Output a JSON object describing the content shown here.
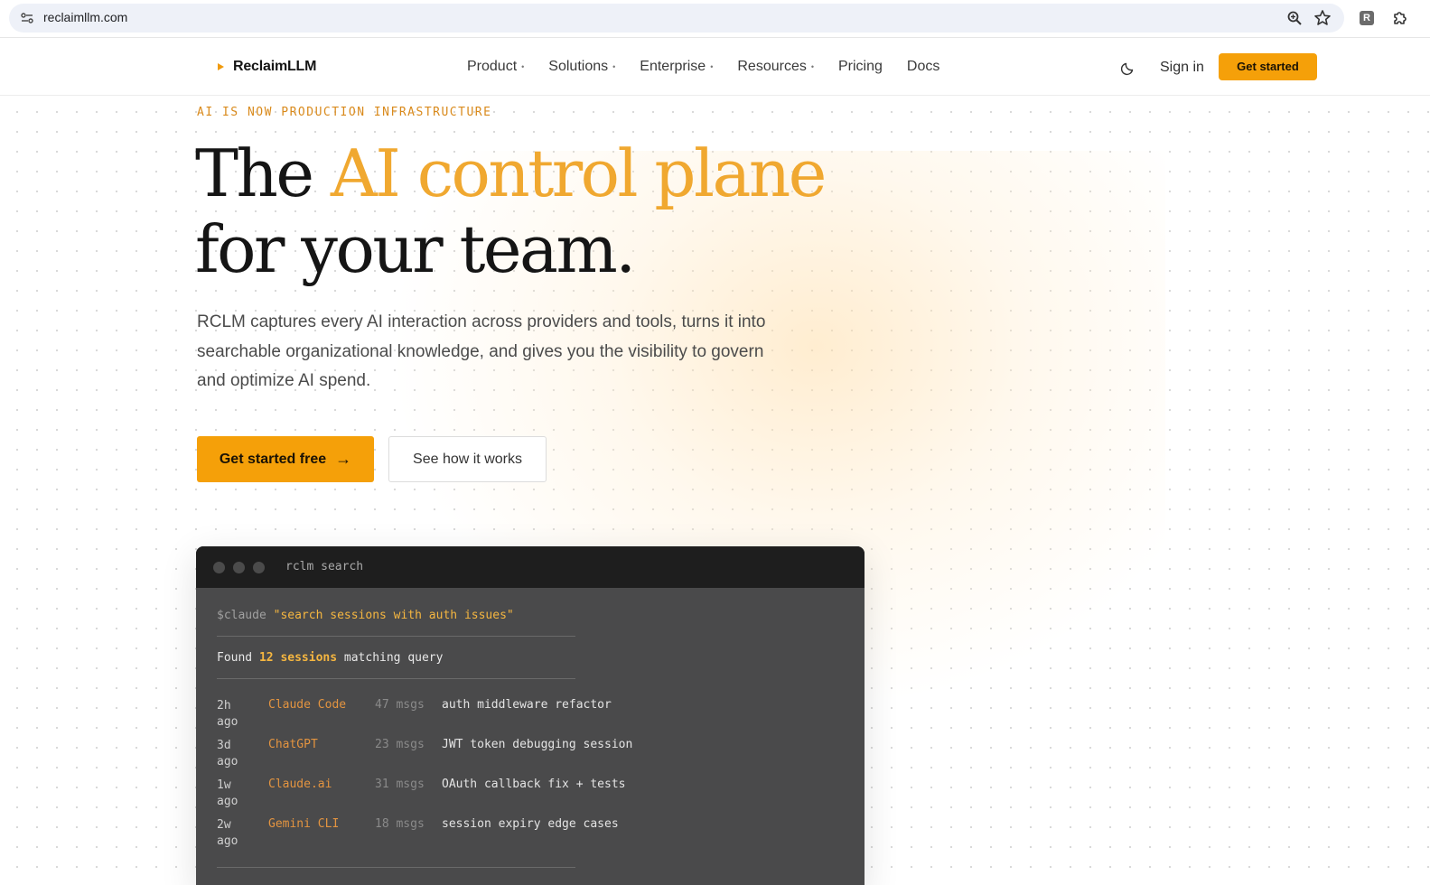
{
  "browser": {
    "url": "reclaimllm.com",
    "extension_letter": "R"
  },
  "nav": {
    "brand": "ReclaimLLM",
    "links": [
      {
        "label": "Product",
        "has_caret": true
      },
      {
        "label": "Solutions",
        "has_caret": true
      },
      {
        "label": "Enterprise",
        "has_caret": true
      },
      {
        "label": "Resources",
        "has_caret": true
      },
      {
        "label": "Pricing",
        "has_caret": false
      },
      {
        "label": "Docs",
        "has_caret": false
      }
    ],
    "caret": "•",
    "sign_in": "Sign in",
    "cta": "Get started"
  },
  "hero": {
    "eyebrow": "AI IS NOW PRODUCTION INFRASTRUCTURE",
    "headline_pre": "The ",
    "headline_accent": "AI control plane",
    "headline_post": "for your team.",
    "subcopy": "RCLM captures every AI interaction across providers and tools, turns it into searchable organizational knowledge, and gives you the visibility to govern and optimize AI spend.",
    "primary_button": "Get started free",
    "primary_arrow": "→",
    "secondary_button": "See how it works"
  },
  "terminal": {
    "title": "rclm search",
    "prompt_cmd": "$claude",
    "prompt_query": "\"search sessions with auth issues\"",
    "found_pre": "Found ",
    "found_highlight": "12 sessions",
    "found_post": " matching query",
    "rows": [
      {
        "when": "2h ago",
        "tool": "Claude Code",
        "msgs": "47 msgs",
        "desc": "auth middleware refactor"
      },
      {
        "when": "3d ago",
        "tool": "ChatGPT",
        "msgs": "23 msgs",
        "desc": "JWT token debugging session"
      },
      {
        "when": "1w ago",
        "tool": "Claude.ai",
        "msgs": "31 msgs",
        "desc": "OAuth callback fix + tests"
      },
      {
        "when": "2w ago",
        "tool": "Gemini CLI",
        "msgs": "18 msgs",
        "desc": "session expiry edge cases"
      }
    ]
  },
  "colors": {
    "accent": "#f5a009",
    "headline_accent": "#f0a830",
    "terminal_bg": "#4a4a4b",
    "terminal_bar": "#1e1e1e",
    "tool_text": "#e39440"
  },
  "icons": [
    "site-info-icon",
    "zoom-icon",
    "star-icon",
    "puzzle-icon",
    "moon-icon",
    "arrow-right-icon"
  ]
}
